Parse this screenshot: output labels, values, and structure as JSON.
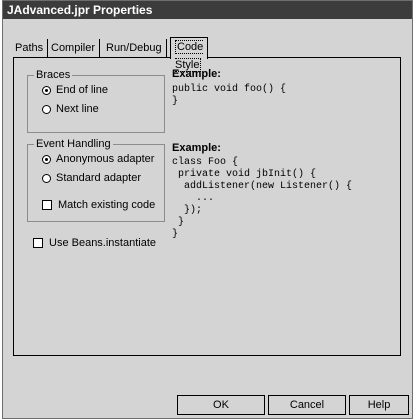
{
  "window": {
    "title": "JAdvanced.jpr Properties"
  },
  "tabs": [
    {
      "label": "Paths"
    },
    {
      "label": "Compiler"
    },
    {
      "label": "Run/Debug"
    },
    {
      "label": "Code Style",
      "active": true
    }
  ],
  "braces": {
    "title": "Braces",
    "options": [
      {
        "label": "End of line",
        "selected": true
      },
      {
        "label": "Next line",
        "selected": false
      }
    ]
  },
  "example1": {
    "heading": "Example:",
    "code": "public void foo() {\n}"
  },
  "event_handling": {
    "title": "Event Handling",
    "options": [
      {
        "label": "Anonymous adapter",
        "selected": true
      },
      {
        "label": "Standard adapter",
        "selected": false
      }
    ],
    "match_existing": {
      "label": "Match existing code",
      "checked": false
    }
  },
  "example2": {
    "heading": "Example:",
    "code": "class Foo {\n private void jbInit() {\n  addListener(new Listener() {\n    ...\n  });\n }\n}"
  },
  "use_beans": {
    "label": "Use Beans.instantiate",
    "checked": false
  },
  "buttons": {
    "ok": "OK",
    "cancel": "Cancel",
    "help": "Help"
  }
}
